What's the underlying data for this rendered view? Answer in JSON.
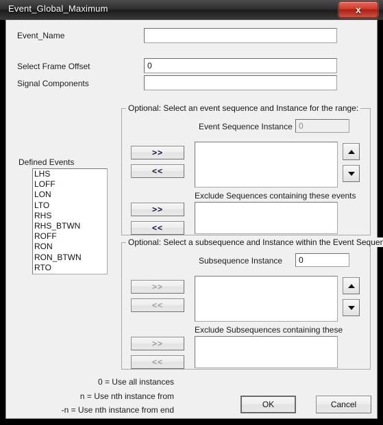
{
  "window": {
    "title": "Event_Global_Maximum",
    "close_label": "x"
  },
  "form": {
    "event_name": {
      "label": "Event_Name",
      "value": ""
    },
    "frame_offset": {
      "label": "Select Frame Offset",
      "value": "0"
    },
    "signal_components": {
      "label": "Signal Components",
      "value": ""
    }
  },
  "defined_events": {
    "label": "Defined Events",
    "items": [
      "LHS",
      "LOFF",
      "LON",
      "LTO",
      "RHS",
      "RHS_BTWN",
      "ROFF",
      "RON",
      "RON_BTWN",
      "RTO"
    ]
  },
  "sequence_group": {
    "legend": "Optional: Select an event sequence and Instance for the range:",
    "instance_label": "Event Sequence Instance",
    "instance_value": "0",
    "add_button": ">>",
    "remove_button": "<<",
    "exclude_label": "Exclude Sequences containing these events",
    "exclude_add_button": ">>",
    "exclude_remove_button": "<<",
    "spin_up": "up-arrow",
    "spin_down": "down-arrow",
    "list_items": [],
    "exclude_list_items": []
  },
  "subsequence_group": {
    "legend": "Optional: Select a subsequence and Instance within the Event Sequence",
    "instance_label": "Subsequence Instance",
    "instance_value": "0",
    "add_button": ">>",
    "remove_button": "<<",
    "exclude_label": "Exclude Subsequences containing these",
    "exclude_add_button": ">>",
    "exclude_remove_button": "<<",
    "spin_up": "up-arrow",
    "spin_down": "down-arrow",
    "list_items": [],
    "exclude_list_items": []
  },
  "help": {
    "line1": "0 = Use all instances",
    "line2": "n = Use nth instance from",
    "line3": "-n = Use nth instance from end"
  },
  "buttons": {
    "ok": "OK",
    "cancel": "Cancel"
  },
  "colors": {
    "close_red": "#cf3b2a",
    "titlebar_dark": "#2f2f2f",
    "client_bg": "#f0f0f0"
  }
}
